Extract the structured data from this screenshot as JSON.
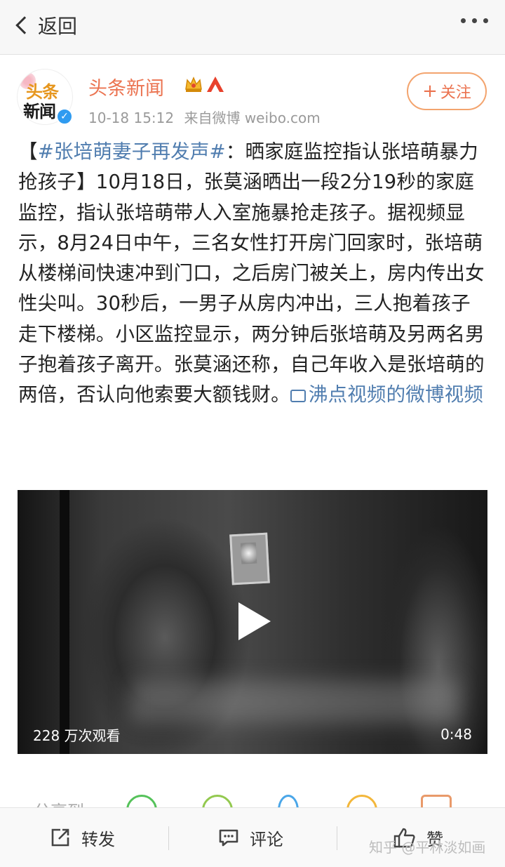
{
  "nav": {
    "back_label": "返回"
  },
  "author": {
    "name": "头条新闻",
    "avatar_text_top": "头条",
    "avatar_text_bottom": "新闻",
    "time": "10-18 15:12",
    "source": "来自微博 weibo.com",
    "follow_label": "关注"
  },
  "post": {
    "bracket_open": "【",
    "hashtag": "#张培萌妻子再发声#",
    "body_after_hashtag": "：晒家庭监控指认张培萌暴力抢孩子】10月18日，张莫涵晒出一段2分19秒的家庭监控，指认张培萌带人入室施暴抢走孩子。据视频显示，8月24日中午，三名女性打开房门回家时，张培萌从楼梯间快速冲到门口，之后房门被关上，房内传出女性尖叫。30秒后，一男子从房内冲出，三人抱着孩子走下楼梯。小区监控显示，两分钟后张培萌及另两名男子抱着孩子离开。张莫涵还称，自己年收入是张培萌的两倍，否认向他索要大额钱财。",
    "video_link": "沸点视频的微博视频"
  },
  "video": {
    "views": "228 万次观看",
    "duration": "0:48"
  },
  "share": {
    "label": "分享到"
  },
  "bottom_bar": {
    "repost_label": "转发",
    "comment_label": "评论",
    "like_label": "赞"
  },
  "watermark": "知乎 @平林淡如画",
  "colors": {
    "accent": "#eb7350",
    "link": "#507daf",
    "verified": "#2f9bf0"
  }
}
